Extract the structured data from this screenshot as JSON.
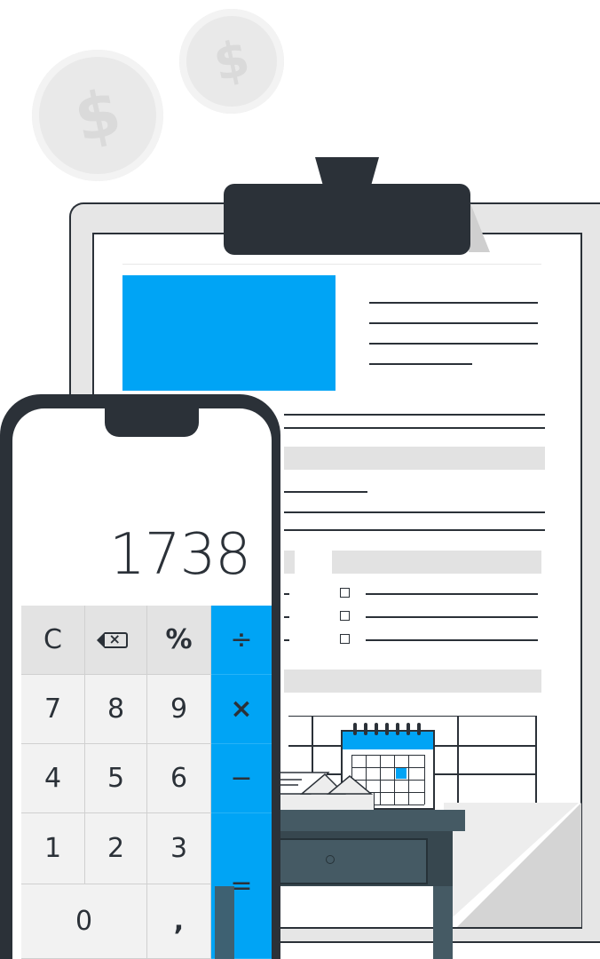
{
  "coins": [
    {
      "symbol": "$"
    },
    {
      "symbol": "$"
    }
  ],
  "calculator": {
    "display_value": "1738",
    "keys": {
      "clear": "C",
      "backspace": "⌫",
      "percent": "%",
      "divide": "÷",
      "seven": "7",
      "eight": "8",
      "nine": "9",
      "multiply": "×",
      "four": "4",
      "five": "5",
      "six": "6",
      "minus": "−",
      "one": "1",
      "two": "2",
      "three": "3",
      "zero": "0",
      "comma": ",",
      "equals": "="
    }
  },
  "colors": {
    "accent": "#00a4f5",
    "dark": "#2b3138",
    "desk": "#455a64",
    "paper": "#ffffff",
    "board": "#e6e6e6"
  }
}
